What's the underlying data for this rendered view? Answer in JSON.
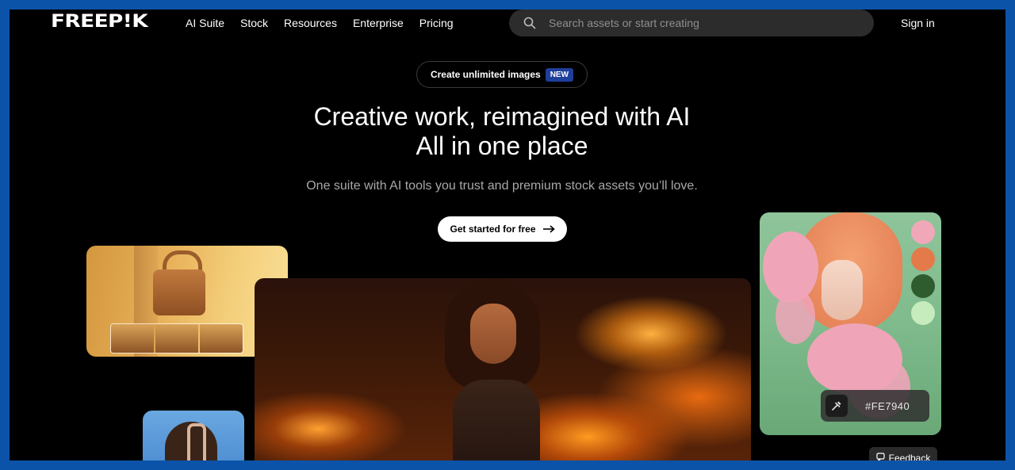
{
  "header": {
    "logo": "FREEP!K",
    "nav": [
      "AI Suite",
      "Stock",
      "Resources",
      "Enterprise",
      "Pricing"
    ],
    "search_placeholder": "Search assets or start creating",
    "sign_in": "Sign in"
  },
  "hero": {
    "pill_text": "Create unlimited images",
    "pill_badge": "NEW",
    "headline_line1": "Creative work, reimagined with AI",
    "headline_line2": "All in one place",
    "subline": "One suite with AI tools you trust and premium stock assets you’ll love.",
    "cta_label": "Get started for free"
  },
  "color_card": {
    "hex": "#FE7940",
    "swatches": [
      "#f0a8b8",
      "#e47a4a",
      "#2f5c2f",
      "#c6ecbe"
    ]
  },
  "feedback_label": "Feedback"
}
